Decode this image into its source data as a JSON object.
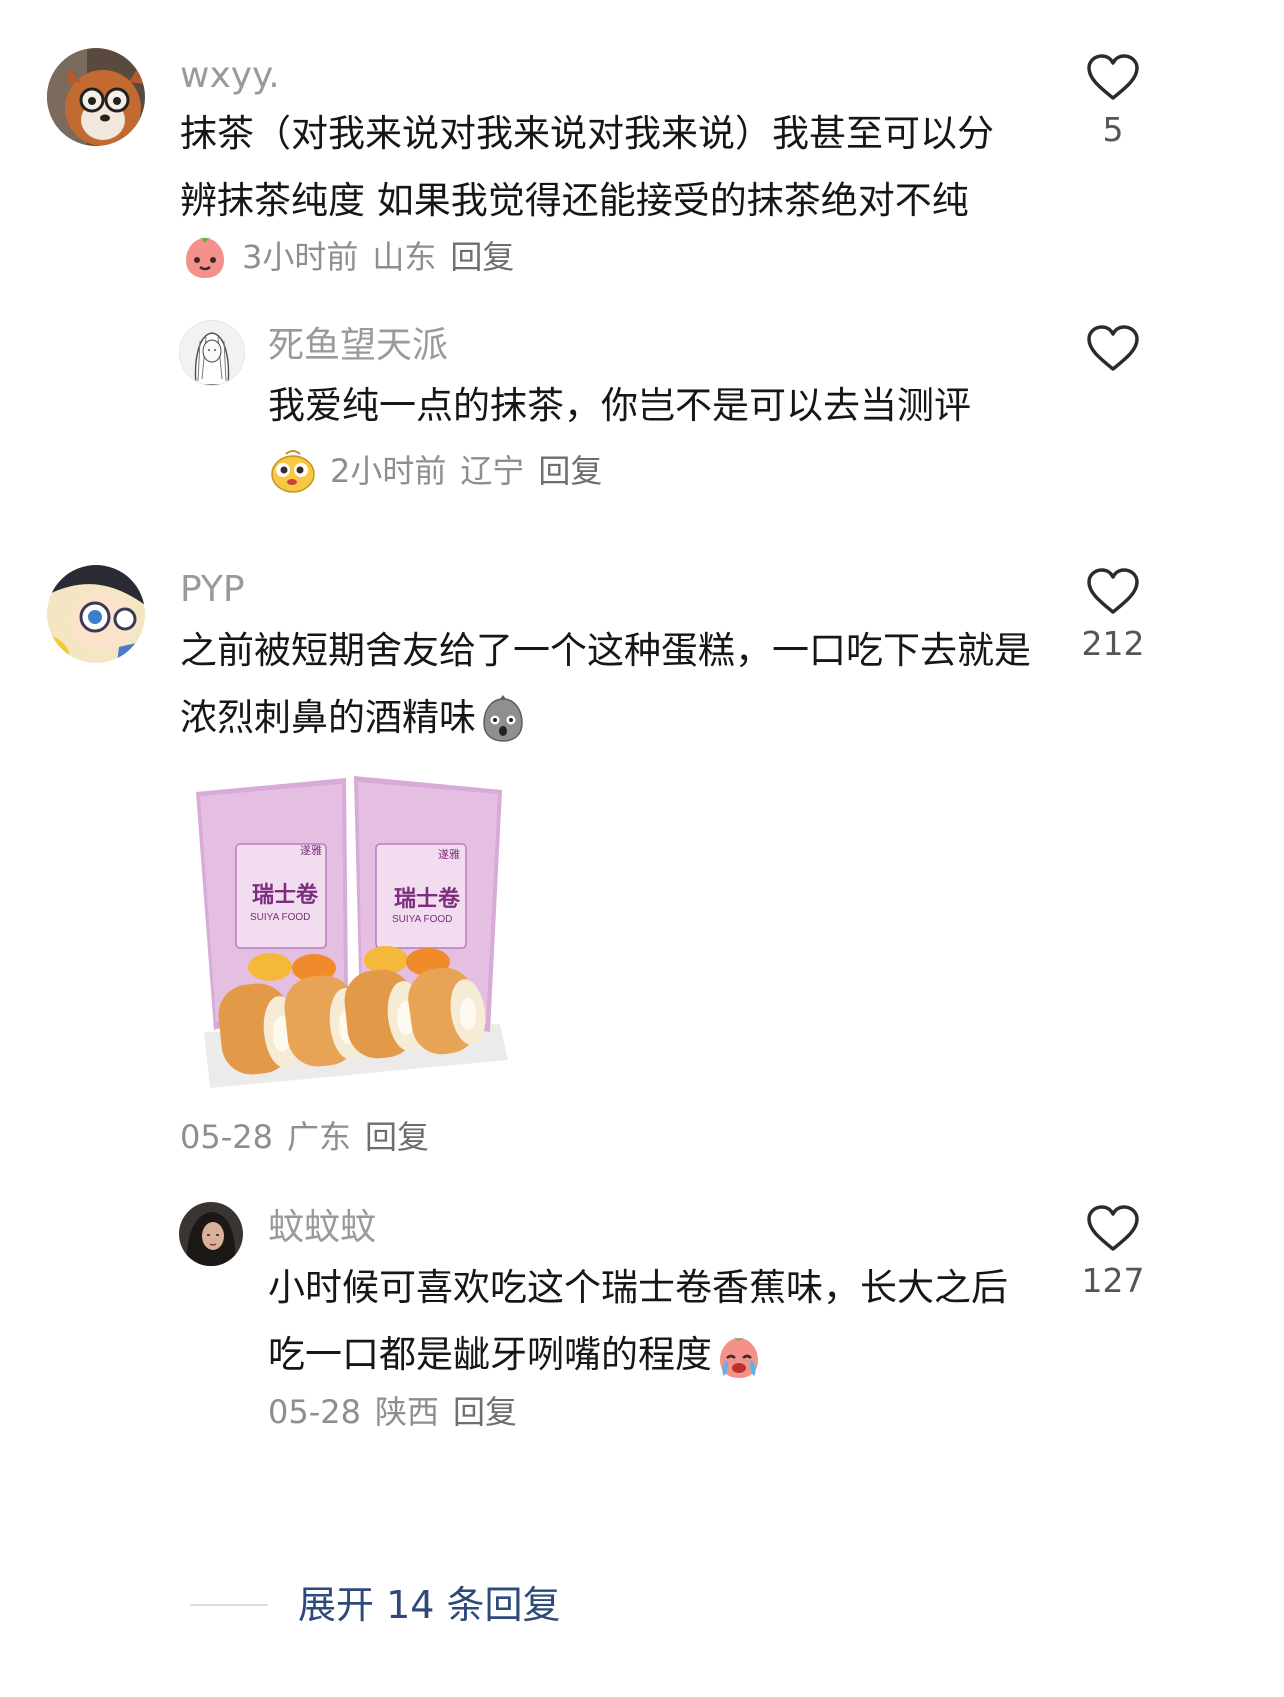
{
  "comments": [
    {
      "user": "wxyy.",
      "text": "抹茶（对我来说对我来说对我来说）我甚至可以分辨抹茶纯度 如果我觉得还能接受的抹茶绝对不纯",
      "time": "3小时前",
      "location": "山东",
      "reply_label": "回复",
      "likes": "5",
      "sticker": "peach-face-sticker",
      "avatar": "squirrel-with-glasses-avatar"
    },
    {
      "user": "死鱼望天派",
      "text": "我爱纯一点的抹茶，你岂不是可以去当测评",
      "time": "2小时前",
      "location": "辽宁",
      "reply_label": "回复",
      "likes": "",
      "sticker": "yellow-blob-sticker",
      "avatar": "sketch-girl-avatar"
    },
    {
      "user": "PYP",
      "text": "之前被短期舍友给了一个这种蛋糕，一口吃下去就是浓烈刺鼻的酒精味",
      "time": "05-28",
      "location": "广东",
      "reply_label": "回复",
      "likes": "212",
      "emoji": "shocked-gray-blob-emoji",
      "avatar": "anime-boy-glasses-avatar",
      "image": {
        "brand": "遂雅",
        "product": "瑞士卷",
        "brand_en": "SUIYA FOOD"
      }
    },
    {
      "user": "蚊蚊蚊",
      "text": "小时候可喜欢吃这个瑞士卷香蕉味，长大之后吃一口都是龇牙咧嘴的程度",
      "time": "05-28",
      "location": "陕西",
      "reply_label": "回复",
      "likes": "127",
      "emoji": "crying-peach-emoji",
      "avatar": "dark-hair-woman-avatar"
    }
  ],
  "expand_label": "展开 14 条回复",
  "colors": {
    "accent_link": "#2d4a7a",
    "username": "#9a9a9a",
    "meta": "#8e8e8e"
  }
}
